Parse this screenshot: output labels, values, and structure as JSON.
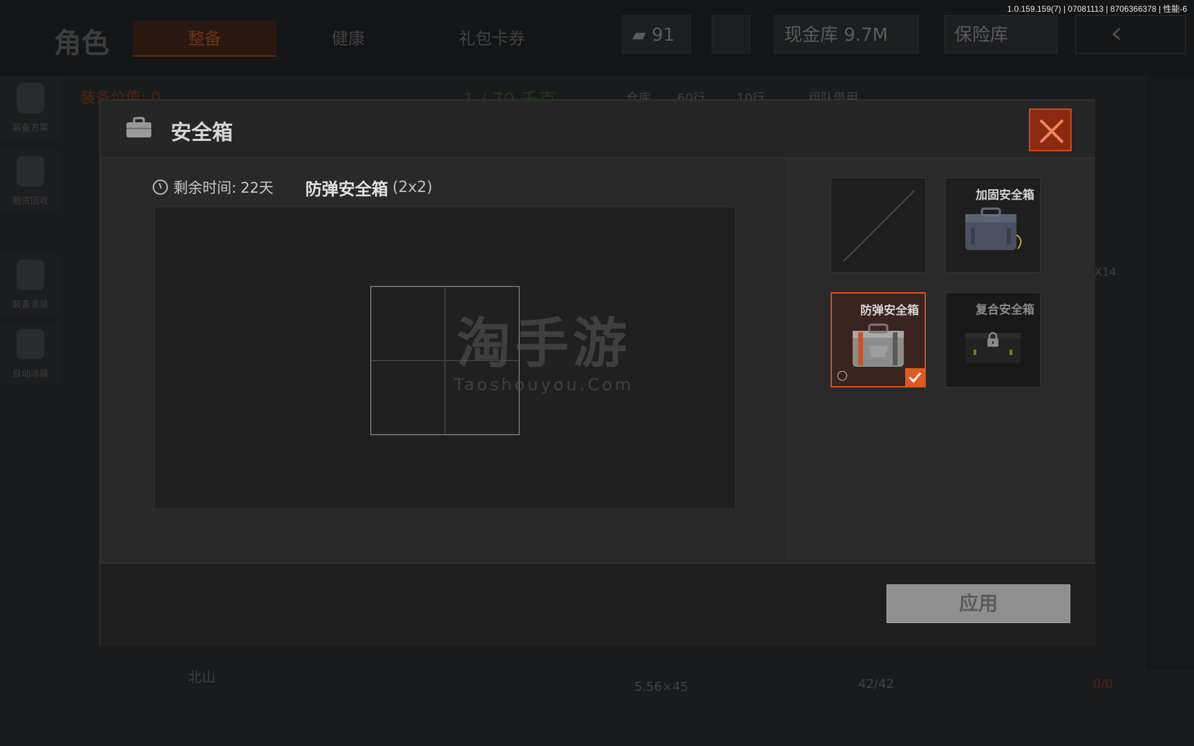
{
  "status_bar": {
    "version": "1.0.159.159(7) | 07081113 | 8706366378 | 性能-6"
  },
  "background": {
    "title": "角色",
    "tabs": [
      "整备",
      "健康",
      "礼包卡券"
    ],
    "bullets": "91",
    "cash": "现金库 9.7M",
    "vault": "保险库",
    "sidebar": [
      "装备方案",
      "物资回收",
      "装备涂装",
      "自动涂装"
    ],
    "equip_value": "装备价值: 0",
    "weight": "1 / 70 千克",
    "warehouse": "仓库",
    "rows_a": "60行",
    "rows_b": "10行",
    "team": "组队借用",
    "ammo": "5.56×45",
    "ammo_count": "42/42",
    "location": "北山",
    "stack": "X14",
    "counter": "0/0"
  },
  "modal": {
    "title": "安全箱",
    "close_icon": "close-icon",
    "remaining_label": "剩余时间:",
    "remaining_value": "22天",
    "case_name": "防弹安全箱",
    "case_size": "(2x2)",
    "grid": {
      "rows": 2,
      "cols": 2
    },
    "watermark": {
      "cn": "淘手游",
      "en": "Taoshouyou.Com"
    },
    "slots": [
      {
        "label": "",
        "state": "empty"
      },
      {
        "label": "加固安全箱",
        "state": "available"
      },
      {
        "label": "防弹安全箱",
        "state": "selected"
      },
      {
        "label": "复合安全箱",
        "state": "locked"
      }
    ],
    "apply_label": "应用"
  },
  "colors": {
    "accent": "#d8531f",
    "check": "#e2591f",
    "close_bg": "#8a2a10"
  }
}
